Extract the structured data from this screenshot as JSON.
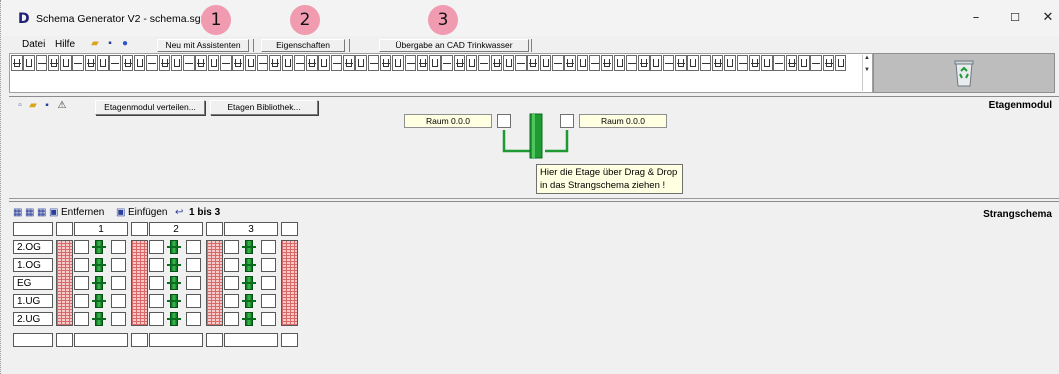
{
  "window": {
    "app_icon_letter": "D",
    "title": "Schema Generator V2  -  schema.sg2",
    "controls": {
      "minimize": "–",
      "maximize": "☐",
      "close": "✕"
    }
  },
  "badges": [
    "1",
    "2",
    "3"
  ],
  "menu": {
    "items": [
      "Datei",
      "Hilfe"
    ],
    "buttons": [
      "Neu mit Assistenten",
      "Eigenschaften",
      "Übergabe an CAD Trinkwasser"
    ]
  },
  "etagenmodul": {
    "title": "Etagenmodul",
    "buttons": [
      "Etagenmodul verteilen...",
      "Etagen Bibliothek..."
    ],
    "raum_left": "Raum 0.0.0",
    "raum_right": "Raum 0.0.0",
    "tooltip_line1": "Hier die Etage über Drag & Drop",
    "tooltip_line2": "in das Strangschema ziehen !"
  },
  "strangschema": {
    "title": "Strangschema",
    "remove_label": "Entfernen",
    "insert_label": "Einfügen",
    "range_label": "1 bis  3",
    "columns": [
      "1",
      "2",
      "3"
    ],
    "floors": [
      "2.OG",
      "1.OG",
      "EG",
      "1.UG",
      "2.UG"
    ]
  },
  "colors": {
    "badge": "#f19bb1",
    "pipe_green": "#1f9a33",
    "tooltip_bg": "#ffffe1",
    "brick": "#d86a6a"
  },
  "icons": [
    "new-file-icon",
    "open-folder-icon",
    "save-disk-icon",
    "help-icon",
    "recycle-bin-icon",
    "undo-icon"
  ]
}
